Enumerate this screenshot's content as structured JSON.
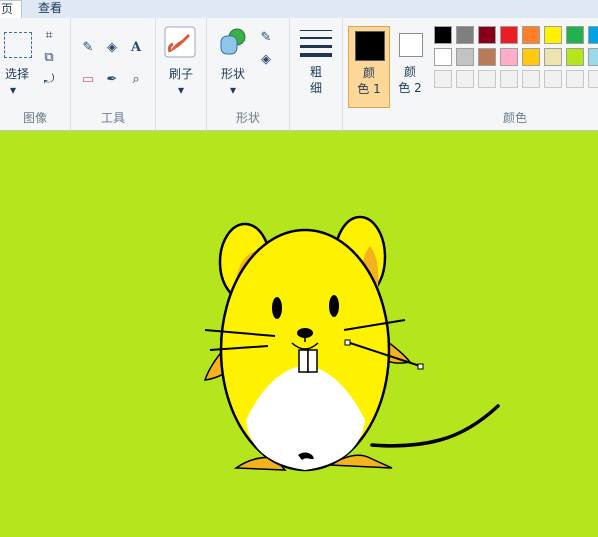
{
  "tabs": [
    {
      "label": "页"
    },
    {
      "label": "查看"
    }
  ],
  "groups": {
    "image": {
      "label": "图像",
      "select_label": "选择"
    },
    "tools": {
      "label": "工具"
    },
    "brushes": {
      "label": "刷子"
    },
    "shapes": {
      "label": "形状",
      "shapes_label": "形状"
    },
    "size": {
      "label_line1": "粗",
      "label_line2": "细"
    },
    "color1": {
      "label_line1": "颜",
      "label_line2": "色 1",
      "value": "#000000"
    },
    "color2": {
      "label_line1": "颜",
      "label_line2": "色 2",
      "value": "#ffffff"
    },
    "colors": {
      "label": "颜色"
    }
  },
  "palette_row1": [
    "#000000",
    "#7f7f7f",
    "#880015",
    "#ed1c24",
    "#ff7f27",
    "#fff200",
    "#22b14c",
    "#00a2e8"
  ],
  "palette_row2": [
    "#ffffff",
    "#c3c3c3",
    "#b97a57",
    "#ffaec9",
    "#ffc90e",
    "#efe4b0",
    "#b5e61d",
    "#99d9ea"
  ],
  "canvas": {
    "background": "#b5e61d"
  }
}
